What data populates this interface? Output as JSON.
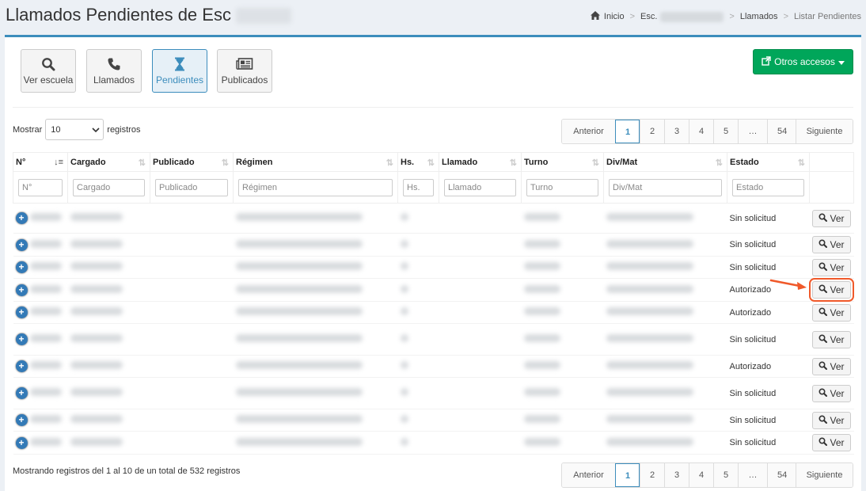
{
  "header": {
    "title": "Llamados Pendientes de Esc",
    "breadcrumb": {
      "home": "Inicio",
      "school": "Esc.",
      "section": "Llamados",
      "current": "Listar Pendientes"
    }
  },
  "toolbar": {
    "buttons": [
      {
        "label": "Ver escuela",
        "icon": "search-icon"
      },
      {
        "label": "Llamados",
        "icon": "phone-icon"
      },
      {
        "label": "Pendientes",
        "icon": "hourglass-icon",
        "active": true
      },
      {
        "label": "Publicados",
        "icon": "newspaper-icon"
      }
    ],
    "otros_accesos": "Otros accesos"
  },
  "length": {
    "prefix": "Mostrar",
    "value": "10",
    "suffix": "registros"
  },
  "pagination": {
    "prev": "Anterior",
    "pages": [
      "1",
      "2",
      "3",
      "4",
      "5",
      "…",
      "54"
    ],
    "current": "1",
    "next": "Siguiente"
  },
  "table": {
    "columns": [
      "N°",
      "Cargado",
      "Publicado",
      "Régimen",
      "Hs.",
      "Llamado",
      "Turno",
      "Div/Mat",
      "Estado",
      ""
    ],
    "filters": [
      "N°",
      "Cargado",
      "Publicado",
      "Régimen",
      "Hs.",
      "Llamado",
      "Turno",
      "Div/Mat",
      "Estado"
    ],
    "rows": [
      {
        "estado": "Sin solicitud",
        "action": "Ver"
      },
      {
        "estado": "Sin solicitud",
        "action": "Ver"
      },
      {
        "estado": "Sin solicitud",
        "action": "Ver"
      },
      {
        "estado": "Autorizado",
        "action": "Ver"
      },
      {
        "estado": "Autorizado",
        "action": "Ver"
      },
      {
        "estado": "Sin solicitud",
        "action": "Ver"
      },
      {
        "estado": "Autorizado",
        "action": "Ver"
      },
      {
        "estado": "Sin solicitud",
        "action": "Ver"
      },
      {
        "estado": "Sin solicitud",
        "action": "Ver"
      },
      {
        "estado": "Sin solicitud",
        "action": "Ver"
      }
    ]
  },
  "info": "Mostrando registros del 1 al 10 de un total de 532 registros",
  "colors": {
    "accent": "#3c8dbc",
    "success": "#00a65a",
    "highlight": "#f0592a"
  }
}
